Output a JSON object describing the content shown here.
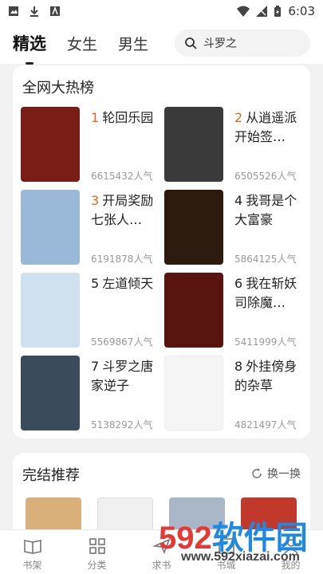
{
  "statusbar": {
    "time": "6:03",
    "icons": [
      "image-icon",
      "download-icon",
      "font-icon",
      "wifi-icon",
      "signal-icon",
      "battery-icon"
    ]
  },
  "header": {
    "tabs": [
      {
        "label": "精选",
        "active": true
      },
      {
        "label": "女生"
      },
      {
        "label": "男生"
      }
    ],
    "search_text": "斗罗之"
  },
  "hot": {
    "title": "全网大热榜",
    "books": [
      {
        "rank": "1",
        "title": "轮回乐园",
        "popularity": "6615432人气",
        "color": "#7a1d16"
      },
      {
        "rank": "2",
        "title": "从逍遥派开始签…",
        "popularity": "6505526人气",
        "color": "#3a3a3a"
      },
      {
        "rank": "3",
        "title": "开局奖励七张人…",
        "popularity": "6191878人气",
        "color": "#9ab8d8"
      },
      {
        "rank": "4",
        "title": "我哥是个大富豪",
        "popularity": "5864125人气",
        "color": "#2b1a0d"
      },
      {
        "rank": "5",
        "title": "左道倾天",
        "popularity": "5569867人气",
        "color": "#cfe0ee"
      },
      {
        "rank": "6",
        "title": "我在斩妖司除魔…",
        "popularity": "5411999人气",
        "color": "#5a1410"
      },
      {
        "rank": "7",
        "title": "斗罗之唐家逆子",
        "popularity": "5138292人气",
        "color": "#3a4c5c"
      },
      {
        "rank": "8",
        "title": "外挂傍身的杂草",
        "popularity": "4821497人气",
        "color": "#f5f5f5"
      }
    ]
  },
  "completed": {
    "title": "完结推荐",
    "refresh_label": "换一换",
    "cover_colors": [
      "#d9b07a",
      "#f0f0f0",
      "#a9b6c8",
      "#c0392b"
    ]
  },
  "nav": [
    {
      "label": "书架",
      "icon": "book-icon"
    },
    {
      "label": "分类",
      "icon": "grid-icon"
    },
    {
      "label": "求书",
      "icon": "send-icon"
    },
    {
      "label": "书城",
      "icon": "store-icon"
    },
    {
      "label": "我的",
      "icon": "user-icon"
    }
  ],
  "watermark": {
    "brand": "592软件园",
    "url": "www.592xiazai.com"
  }
}
